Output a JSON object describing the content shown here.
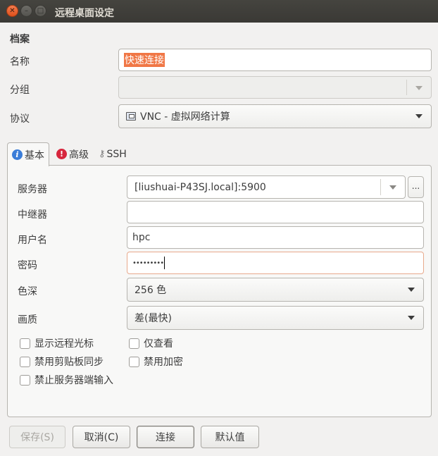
{
  "window": {
    "title": "远程桌面设定",
    "close_glyph": "✕",
    "minimize_glyph": "–",
    "maximize_glyph": "□"
  },
  "profile": {
    "section_title": "档案",
    "name_label": "名称",
    "name_value": "快速连接",
    "group_label": "分组",
    "group_value": "",
    "protocol_label": "协议",
    "protocol_value": "VNC - 虚拟网络计算"
  },
  "tabs": [
    {
      "label": "基本",
      "icon": "info-icon",
      "active": true
    },
    {
      "label": "高级",
      "icon": "warning-icon",
      "active": false
    },
    {
      "label": "SSH",
      "icon": "key-icon",
      "active": false
    }
  ],
  "basic": {
    "server_label": "服务器",
    "server_value": "[liushuai-P43SJ.local]:5900",
    "server_browse": "...",
    "repeater_label": "中继器",
    "repeater_value": "",
    "username_label": "用户名",
    "username_value": "hpc",
    "password_label": "密码",
    "password_value": "•••••••••",
    "color_depth_label": "色深",
    "color_depth_value": "256 色",
    "quality_label": "画质",
    "quality_value": "差(最快)"
  },
  "checkboxes": {
    "show_remote_cursor": "显示远程光标",
    "view_only": "仅查看",
    "disable_clipboard_sync": "禁用剪贴板同步",
    "disable_encryption": "禁用加密",
    "disable_server_input": "禁止服务器端输入"
  },
  "buttons": {
    "save": "保存(S)",
    "cancel": "取消(C)",
    "connect": "连接",
    "default": "默认值"
  },
  "colors": {
    "titlebar": "#3c3b37",
    "close_button": "#e95420",
    "selection": "#f07746",
    "focus_border": "#e8a98c"
  }
}
